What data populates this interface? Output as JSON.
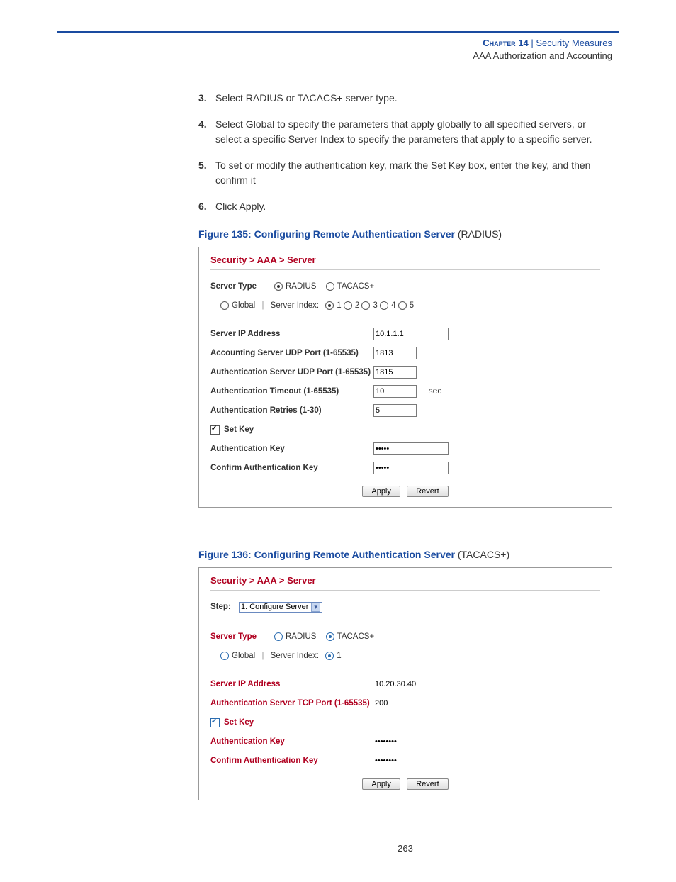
{
  "header": {
    "chapter": "Chapter 14",
    "sep": "|",
    "title": "Security Measures",
    "sub": "AAA Authorization and Accounting"
  },
  "steps": [
    {
      "n": "3.",
      "t": "Select RADIUS or TACACS+ server type."
    },
    {
      "n": "4.",
      "t": "Select Global to specify the parameters that apply globally to all specified servers, or select a specific Server Index to specify the parameters that apply to a specific server."
    },
    {
      "n": "5.",
      "t": "To set or modify the authentication key, mark the Set Key box, enter the key, and then confirm it"
    },
    {
      "n": "6.",
      "t": "Click Apply."
    }
  ],
  "fig1": {
    "caption_title": "Figure 135:  Configuring Remote Authentication Server",
    "caption_sub": "  (RADIUS)",
    "breadcrumb": "Security > AAA > Server",
    "server_type_label": "Server Type",
    "radius": "RADIUS",
    "tacacs": "TACACS+",
    "global": "Global",
    "server_index_label": "Server Index:",
    "idx": [
      "1",
      "2",
      "3",
      "4",
      "5"
    ],
    "rows": {
      "ip_label": "Server IP Address",
      "ip": "10.1.1.1",
      "acct_label": "Accounting Server UDP Port (1-65535)",
      "acct": "1813",
      "auth_port_label": "Authentication Server UDP Port (1-65535)",
      "auth_port": "1815",
      "timeout_label": "Authentication Timeout (1-65535)",
      "timeout": "10",
      "timeout_unit": "sec",
      "retries_label": "Authentication Retries (1-30)",
      "retries": "5",
      "setkey": "Set Key",
      "authkey_label": "Authentication Key",
      "confirmkey_label": "Confirm Authentication Key"
    },
    "apply": "Apply",
    "revert": "Revert"
  },
  "fig2": {
    "caption_title": "Figure 136:  Configuring Remote Authentication Server",
    "caption_sub": "  (TACACS+)",
    "breadcrumb": "Security > AAA > Server",
    "step_label": "Step:",
    "step_value": "1. Configure Server",
    "server_type_label": "Server Type",
    "radius": "RADIUS",
    "tacacs": "TACACS+",
    "global": "Global",
    "server_index_label": "Server Index:",
    "idx1": "1",
    "rows": {
      "ip_label": "Server IP Address",
      "ip": "10.20.30.40",
      "tcp_label": "Authentication Server TCP Port (1-65535)",
      "tcp": "200",
      "setkey": "Set Key",
      "authkey_label": "Authentication Key",
      "confirmkey_label": "Confirm Authentication Key"
    },
    "apply": "Apply",
    "revert": "Revert"
  },
  "pagenum": "–  263  –"
}
